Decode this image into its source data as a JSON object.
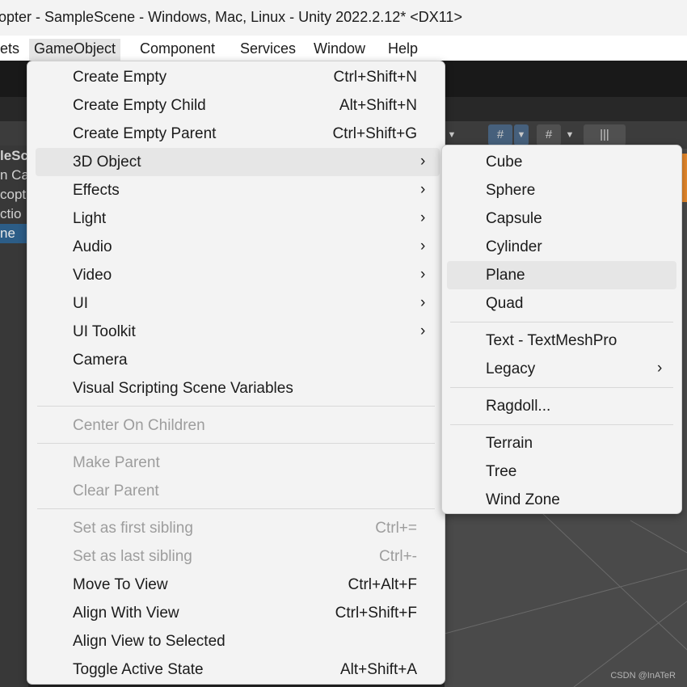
{
  "window": {
    "title": "opter - SampleScene - Windows, Mac, Linux - Unity 2022.2.12* <DX11>"
  },
  "menubar": {
    "items": [
      "ets",
      "GameObject",
      "Component",
      "Services",
      "Window",
      "Help"
    ],
    "active": "GameObject"
  },
  "hierarchy": {
    "rows": [
      "leSc",
      "n Ca",
      "copt",
      "ctio",
      "ne"
    ],
    "selected": "ne"
  },
  "scene_toolbar": {
    "buttons": [
      "#",
      "#",
      "|||"
    ]
  },
  "gameobject_menu": {
    "items": [
      {
        "label": "Create Empty",
        "shortcut": "Ctrl+Shift+N"
      },
      {
        "label": "Create Empty Child",
        "shortcut": "Alt+Shift+N"
      },
      {
        "label": "Create Empty Parent",
        "shortcut": "Ctrl+Shift+G"
      },
      {
        "label": "3D Object",
        "submenu": true,
        "highlighted": true
      },
      {
        "label": "Effects",
        "submenu": true
      },
      {
        "label": "Light",
        "submenu": true
      },
      {
        "label": "Audio",
        "submenu": true
      },
      {
        "label": "Video",
        "submenu": true
      },
      {
        "label": "UI",
        "submenu": true
      },
      {
        "label": "UI Toolkit",
        "submenu": true
      },
      {
        "label": "Camera"
      },
      {
        "label": "Visual Scripting Scene Variables"
      },
      {
        "label": "Center On Children",
        "disabled": true
      },
      {
        "label": "Make Parent",
        "disabled": true
      },
      {
        "label": "Clear Parent",
        "disabled": true
      },
      {
        "label": "Set as first sibling",
        "shortcut": "Ctrl+=",
        "disabled": true
      },
      {
        "label": "Set as last sibling",
        "shortcut": "Ctrl+-",
        "disabled": true
      },
      {
        "label": "Move To View",
        "shortcut": "Ctrl+Alt+F"
      },
      {
        "label": "Align With View",
        "shortcut": "Ctrl+Shift+F"
      },
      {
        "label": "Align View to Selected"
      },
      {
        "label": "Toggle Active State",
        "shortcut": "Alt+Shift+A"
      }
    ],
    "submenu_glyph": "›"
  },
  "object3d_submenu": {
    "items": [
      {
        "label": "Cube"
      },
      {
        "label": "Sphere"
      },
      {
        "label": "Capsule"
      },
      {
        "label": "Cylinder"
      },
      {
        "label": "Plane",
        "highlighted": true
      },
      {
        "label": "Quad"
      },
      {
        "label": "Text - TextMeshPro"
      },
      {
        "label": "Legacy",
        "submenu": true
      },
      {
        "label": "Ragdoll..."
      },
      {
        "label": "Terrain"
      },
      {
        "label": "Tree"
      },
      {
        "label": "Wind Zone"
      }
    ]
  },
  "watermark": "CSDN @InATeR",
  "colors": {
    "menu_bg": "#f3f3f3",
    "highlight": "#e6e6e6",
    "disabled_text": "#9d9d9d",
    "selection": "#2c5d87",
    "accent_orange": "#e98a2c"
  }
}
